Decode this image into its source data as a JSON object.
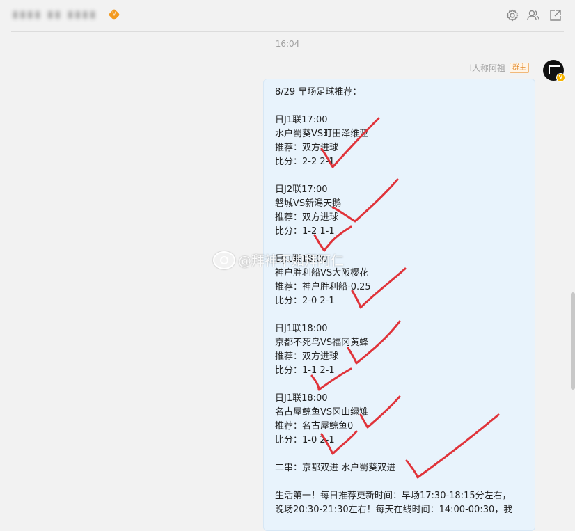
{
  "header": {
    "group_title": "▮▮▮▮ ▮▮ ▮▮▮▮",
    "icons": [
      "settings-gear-icon",
      "group-members-icon",
      "pop-out-window-icon"
    ]
  },
  "timestamp": "16:04",
  "sender": {
    "name": "l人称阿祖",
    "role": "群主"
  },
  "message": {
    "lines": [
      "8/29 早场足球推荐：",
      "",
      "日J1联17:00",
      "水户蜀葵VS町田泽维亚",
      "推荐：双方进球",
      "比分：2-2 2-1",
      "",
      "日J2联17:00",
      "磐城VS新潟天鹅",
      "推荐：双方进球",
      "比分：1-2 1-1",
      "",
      "日J1联18:00",
      "神户胜利船VS大阪樱花",
      "推荐：神户胜利船-0.25",
      "比分：2-0 2-1",
      "",
      "日J1联18:00",
      "京都不死鸟VS福冈黄蜂",
      "推荐：双方进球",
      "比分：1-1 2-1",
      "",
      "日J1联18:00",
      "名古屋鲸鱼VS冈山绿雉",
      "推荐：名古屋鲸鱼0",
      "比分：1-0 2-1",
      "",
      "二串：京都双进 水户蜀葵双进",
      "",
      "生活第一！每日推荐更新时间：早场17:30-18:15分左右，",
      "晚场20:30-21:30左右！每天在线时间：14:00-00:30，我"
    ]
  },
  "watermark": "@拜神不如拜阿仁",
  "colors": {
    "check_marks": "#e0333a",
    "bubble": "#e8f3fc",
    "role_tag": "#e38a2a"
  }
}
